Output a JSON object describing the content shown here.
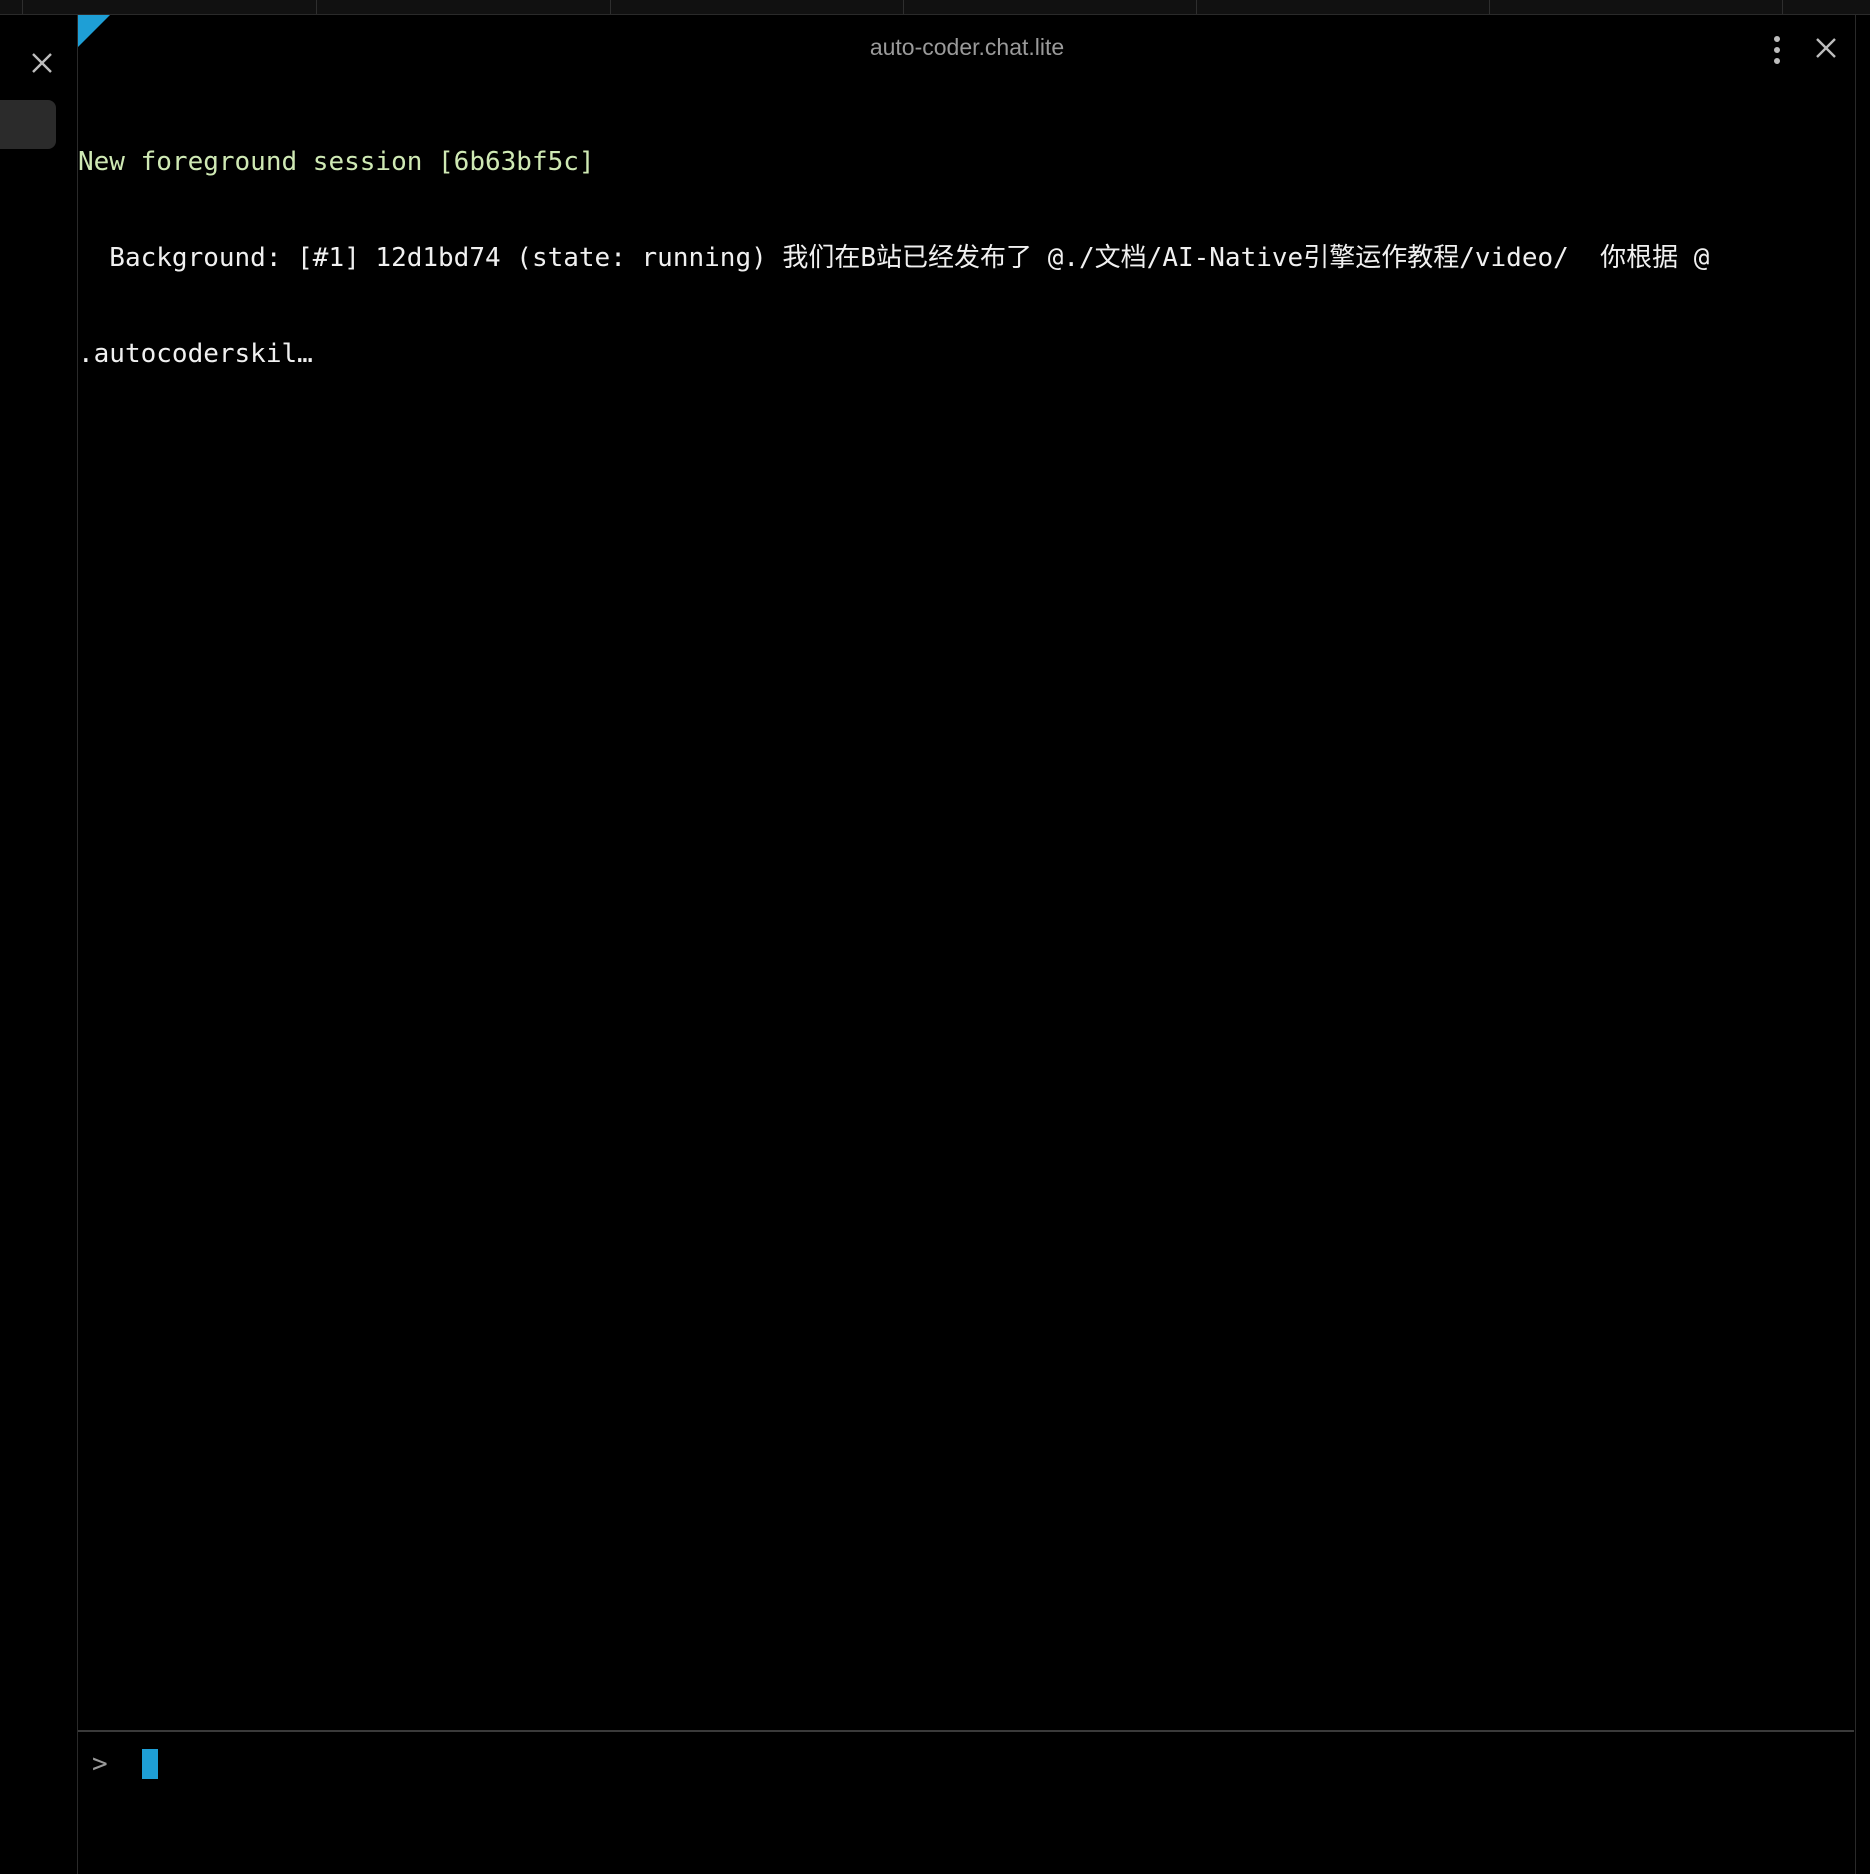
{
  "window": {
    "title": "auto-coder.chat.lite"
  },
  "colors": {
    "accent": "#1e9fd6",
    "session_text": "#cfe9b4",
    "body_text": "#f0f0f0",
    "muted": "#9a9a9a",
    "background": "#000000"
  },
  "icons": {
    "rail_close": "close-icon",
    "menu": "more-vertical-icon",
    "close": "close-icon"
  },
  "terminal": {
    "lines": [
      "New foreground session [6b63bf5c]",
      "  Background: [#1] 12d1bd74 (state: running) 我们在B站已经发布了 @./文档/AI-Native引擎运作教程/video/  你根据 @",
      ".autocoderskil…"
    ]
  },
  "input": {
    "prompt_symbol": ">",
    "value": ""
  }
}
